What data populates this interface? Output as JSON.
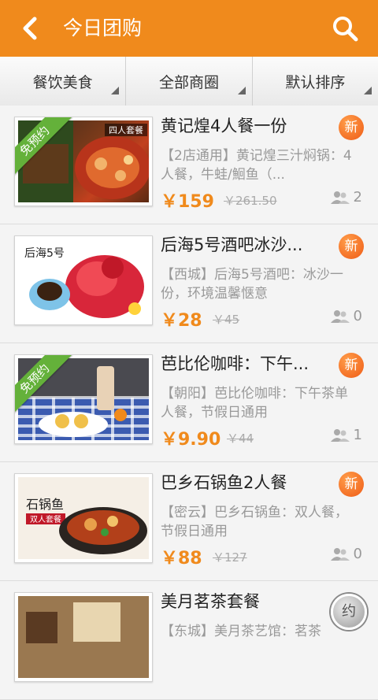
{
  "header": {
    "title": "今日团购",
    "back_icon": "back-arrow-icon",
    "search_icon": "search-icon",
    "bg_color": "#f08a1c"
  },
  "filters": [
    {
      "label": "餐饮美食"
    },
    {
      "label": "全部商圈"
    },
    {
      "label": "默认排序"
    }
  ],
  "deals": [
    {
      "name": "黄记煌4人餐一份",
      "desc": "【2店通用】黄记煌三汁焖锅：4人餐，牛蛙/鮰鱼（...",
      "price": "￥159",
      "old_price": "￥261.50",
      "buyers": "2",
      "badge": "新",
      "ribbon": "免预约"
    },
    {
      "name": "后海5号酒吧冰沙...",
      "desc": "【西城】后海5号酒吧：冰沙一份，环境温馨惬意",
      "price": "￥28",
      "old_price": "￥45",
      "buyers": "0",
      "badge": "新",
      "ribbon": ""
    },
    {
      "name": "芭比伦咖啡：下午...",
      "desc": "【朝阳】芭比伦咖啡：下午茶单人餐，节假日通用",
      "price": "￥9.90",
      "old_price": "￥44",
      "buyers": "1",
      "badge": "新",
      "ribbon": "免预约"
    },
    {
      "name": "巴乡石锅鱼2人餐",
      "desc": "【密云】巴乡石锅鱼：双人餐，节假日通用",
      "price": "￥88",
      "old_price": "￥127",
      "buyers": "0",
      "badge": "新",
      "ribbon": ""
    },
    {
      "name": "美月茗茶套餐",
      "desc": "【东城】美月茶艺馆：茗茶",
      "price": "",
      "old_price": "",
      "buyers": "",
      "badge": "约",
      "ribbon": ""
    }
  ],
  "thumb_texts": {
    "d1_tag": "四人套餐",
    "d2_logo": "后海5号",
    "d4_logo": "石锅鱼",
    "d4_tag": "双人套餐"
  }
}
